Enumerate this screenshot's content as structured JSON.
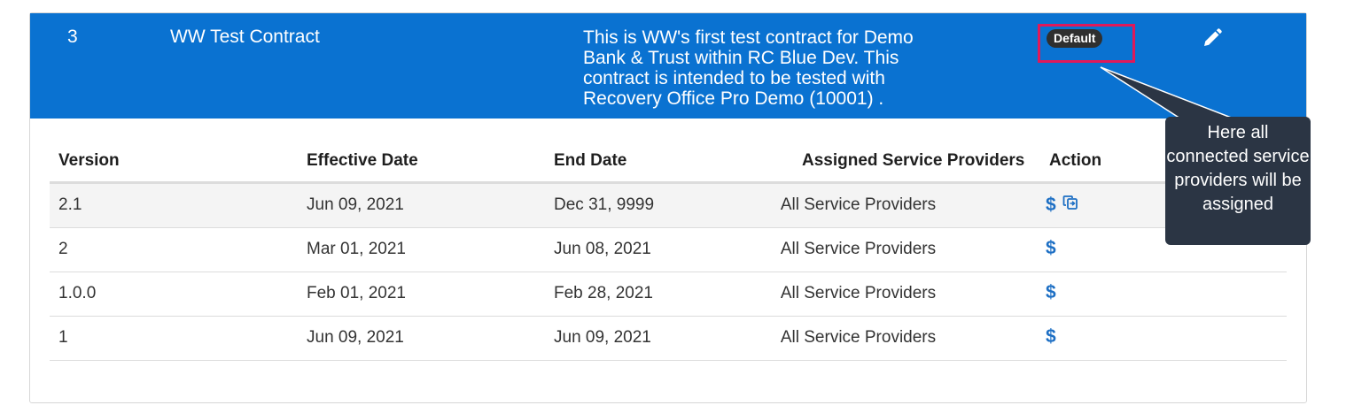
{
  "contract": {
    "number": "3",
    "title": "WW Test Contract",
    "description": "This is WW's first test contract for Demo Bank & Trust within RC Blue Dev. This contract is intended to be tested with Recovery Office Pro Demo (10001) .",
    "badge": "Default",
    "edit_icon": "pencil-icon"
  },
  "colors": {
    "header_bg": "#0a72d1",
    "badge_bg": "#2f2f2f",
    "highlight": "#e0195a",
    "action_icon": "#1d6fc4",
    "tooltip_bg": "#2b3544"
  },
  "table": {
    "columns": [
      "Version",
      "Effective Date",
      "End Date",
      "Assigned Service Providers",
      "Action"
    ],
    "rows": [
      {
        "version": "2.1",
        "effective": "Jun 09, 2021",
        "end": "Dec 31, 9999",
        "providers": "All Service Providers",
        "actions": [
          "dollar-icon",
          "copy-icon"
        ]
      },
      {
        "version": "2",
        "effective": "Mar 01, 2021",
        "end": "Jun 08, 2021",
        "providers": "All Service Providers",
        "actions": [
          "dollar-icon"
        ]
      },
      {
        "version": "1.0.0",
        "effective": "Feb 01, 2021",
        "end": "Feb 28, 2021",
        "providers": "All Service Providers",
        "actions": [
          "dollar-icon"
        ]
      },
      {
        "version": "1",
        "effective": "Jun 09, 2021",
        "end": "Jun 09, 2021",
        "providers": "All Service Providers",
        "actions": [
          "dollar-icon"
        ]
      }
    ],
    "dollar_symbol": "$"
  },
  "tooltip": {
    "text": "Here all connected service providers will be assigned"
  }
}
